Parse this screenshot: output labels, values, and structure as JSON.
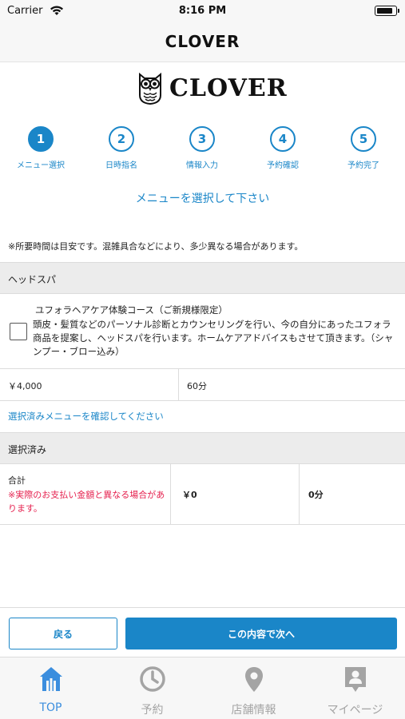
{
  "status_bar": {
    "carrier": "Carrier",
    "time": "8:16 PM",
    "battery_level": 0.85
  },
  "nav": {
    "title": "CLOVER"
  },
  "logo": {
    "text": "CLOVER"
  },
  "steps": [
    {
      "number": "1",
      "label": "メニュー選択",
      "active": true
    },
    {
      "number": "2",
      "label": "日時指名",
      "active": false
    },
    {
      "number": "3",
      "label": "情報入力",
      "active": false
    },
    {
      "number": "4",
      "label": "予約確認",
      "active": false
    },
    {
      "number": "5",
      "label": "予約完了",
      "active": false
    }
  ],
  "instruction": "メニューを選択して下さい",
  "note": "※所要時間は目安です。混雑具合などにより、多少異なる場合があります。",
  "category": {
    "title": "ヘッドスパ"
  },
  "menu_item": {
    "title": "ユフォラヘアケア体験コース（ご新規様限定）",
    "description": "頭皮・髪質などのパーソナル診断とカウンセリングを行い、今の自分にあったユフォラ商品を提案し、ヘッドスパを行います。ホームケアアドバイスもさせて頂きます。（シャンプー・ブロー込み）",
    "price": "￥4,000",
    "duration": "60分",
    "checked": false
  },
  "confirm_link": "選択済みメニューを確認してください",
  "selected_section": {
    "title": "選択済み"
  },
  "total": {
    "label": "合計",
    "warning": "※実際のお支払い金額と異なる場合があります。",
    "amount": "￥0",
    "time": "0分"
  },
  "actions": {
    "back_label": "戻る",
    "next_label": "この内容で次へ"
  },
  "tabs": [
    {
      "label": "TOP",
      "icon": "home-icon",
      "active": true
    },
    {
      "label": "予約",
      "icon": "clock-icon",
      "active": false
    },
    {
      "label": "店舗情報",
      "icon": "location-pin-icon",
      "active": false
    },
    {
      "label": "マイページ",
      "icon": "profile-card-icon",
      "active": false
    }
  ],
  "colors": {
    "accent": "#1a86c8",
    "warning": "#e5204e",
    "tab_active": "#3b8ede",
    "tab_inactive": "#a4a4a4"
  }
}
